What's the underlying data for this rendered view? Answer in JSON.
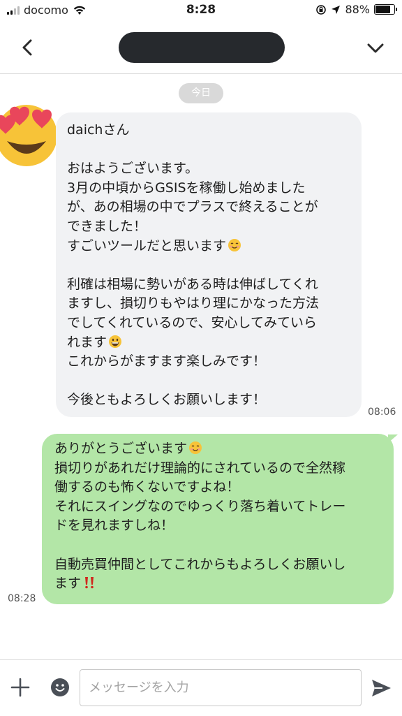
{
  "status_bar": {
    "carrier": "docomo",
    "time": "8:28",
    "battery": "88%",
    "battery_level": 0.88
  },
  "nav": {
    "back_icon": "chevron-left-icon",
    "menu_icon": "chevron-down-icon"
  },
  "chat": {
    "date_label": "今日",
    "incoming": {
      "avatar_icon": "heart-eyes-emoji",
      "lines": [
        "daichさん",
        "",
        "おはようございます。",
        "3月の中頃からGSISを稼働し始めました",
        "が、あの相場の中でプラスで終えることが",
        "できました！",
        "すごいツールだと思います",
        "",
        "利確は相場に勢いがある時は伸ばしてくれ",
        "ますし、損切りもやはり理にかなった方法",
        "でしてくれているので、安心してみていら",
        "れます",
        "これからがますます楽しみです！",
        "",
        "今後ともよろしくお願いします！"
      ],
      "time": "08:06"
    },
    "outgoing": {
      "lines": [
        "ありがとうございます",
        "損切りがあれだけ理論的にされているので全然稼",
        "働するのも怖くないですよね！",
        "それにスイングなのでゆっくり落ち着いてトレー",
        "ドを見れますしね！",
        "",
        "自動売買仲間としてこれからもよろしくお願いし",
        "ます"
      ],
      "time": "08:28"
    }
  },
  "input_bar": {
    "placeholder": "メッセージを入力",
    "plus_icon": "plus-icon",
    "emoji_icon": "smiley-icon",
    "send_icon": "send-icon"
  }
}
